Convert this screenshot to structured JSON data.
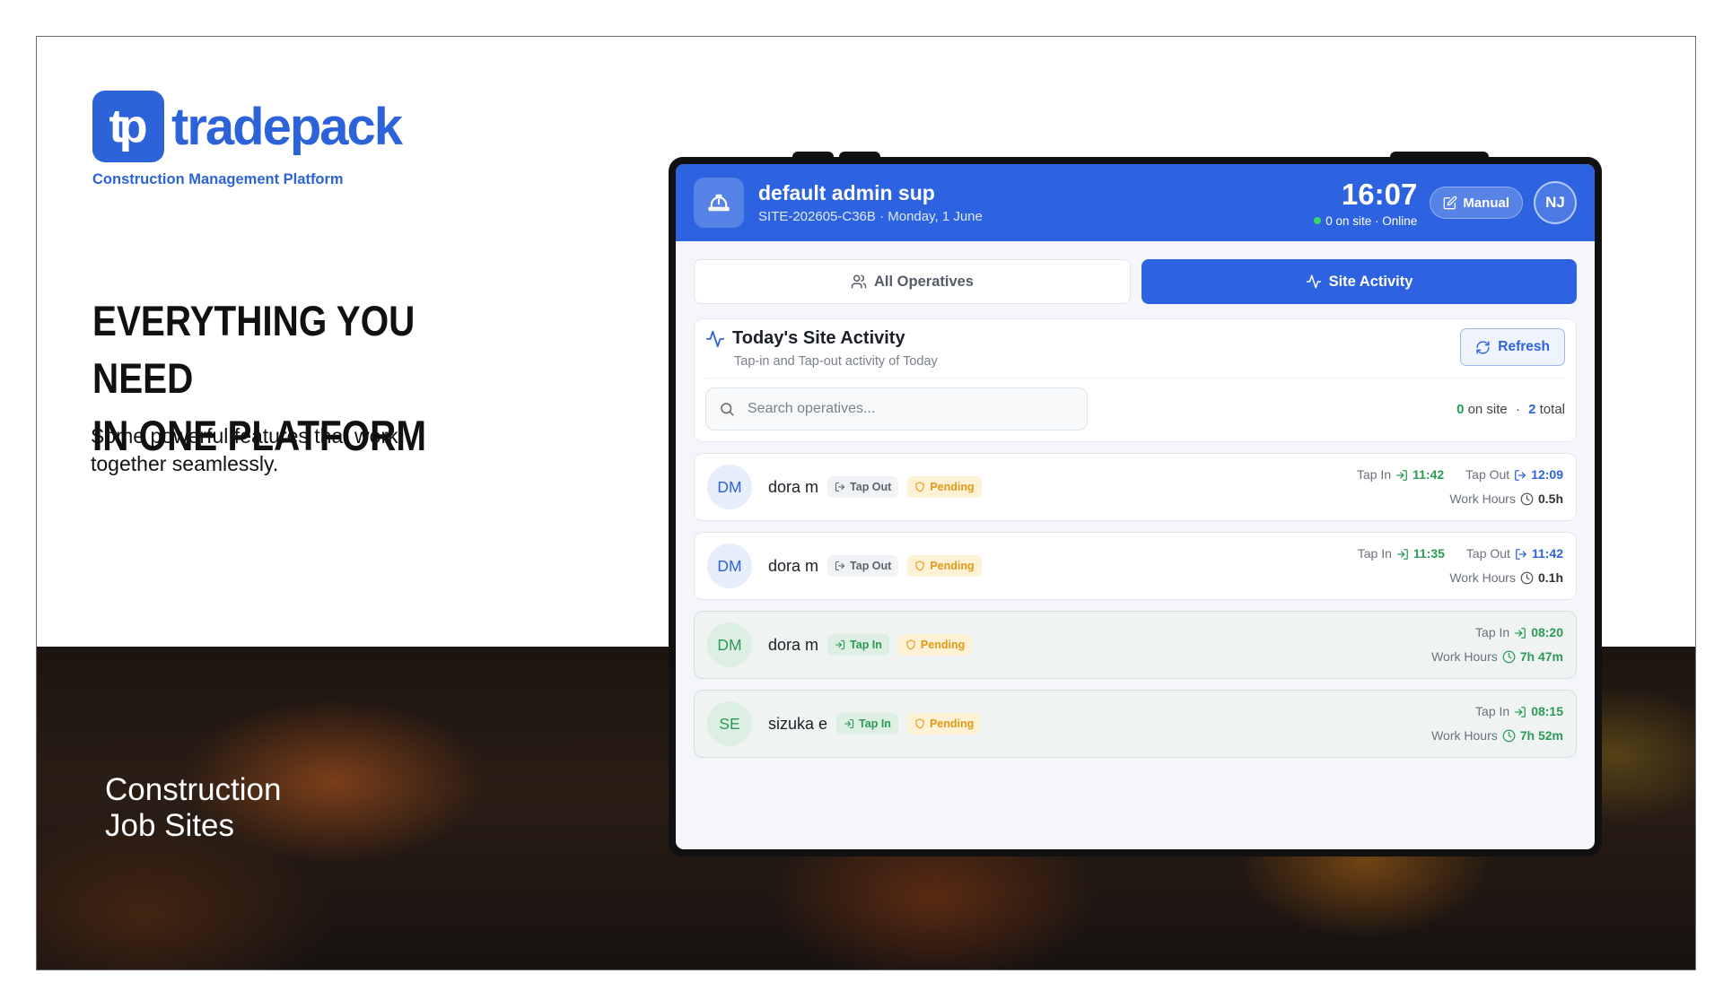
{
  "brand": {
    "logo_mark": "tp",
    "logo_word": "tradepack",
    "tagline": "Construction Management Platform"
  },
  "hero": {
    "headline_1": "EVERYTHING YOU NEED",
    "headline_2": "IN ONE PLATFORM",
    "subtext": "Some powerful features that work together seamlessly."
  },
  "photo_caption": {
    "line1": "Construction",
    "line2": "Job Sites"
  },
  "app": {
    "header": {
      "title": "default admin sup",
      "subtitle": "SITE-202605-C36B · Monday, 1 June",
      "time": "16:07",
      "status": "0 on site · Online",
      "manual_label": "Manual",
      "avatar_initials": "NJ"
    },
    "tabs": [
      {
        "label": "All Operatives",
        "active": false
      },
      {
        "label": "Site Activity",
        "active": true
      }
    ],
    "panel": {
      "title": "Today's Site Activity",
      "subtitle": "Tap-in and Tap-out activity of Today",
      "refresh_label": "Refresh",
      "search_placeholder": "Search operatives...",
      "on_site_count": "0",
      "on_site_label": "on site",
      "separator": "·",
      "total_count": "2",
      "total_label": "total"
    },
    "labels": {
      "tap_in": "Tap In",
      "tap_out": "Tap Out",
      "work_hours": "Work Hours",
      "pending": "Pending"
    },
    "rows": [
      {
        "initials": "DM",
        "name": "dora m",
        "status": "Tap Out",
        "tap_in": "11:42",
        "tap_out": "12:09",
        "hours": "0.5h"
      },
      {
        "initials": "DM",
        "name": "dora m",
        "status": "Tap Out",
        "tap_in": "11:35",
        "tap_out": "11:42",
        "hours": "0.1h"
      },
      {
        "initials": "DM",
        "name": "dora m",
        "status": "Tap In",
        "tap_in": "08:20",
        "tap_out": "",
        "hours": "7h 47m"
      },
      {
        "initials": "SE",
        "name": "sizuka e",
        "status": "Tap In",
        "tap_in": "08:15",
        "tap_out": "",
        "hours": "7h 52m"
      }
    ],
    "colors": {
      "primary": "#2d63e0",
      "success": "#2b9a54",
      "pending": "#e09a16"
    }
  }
}
